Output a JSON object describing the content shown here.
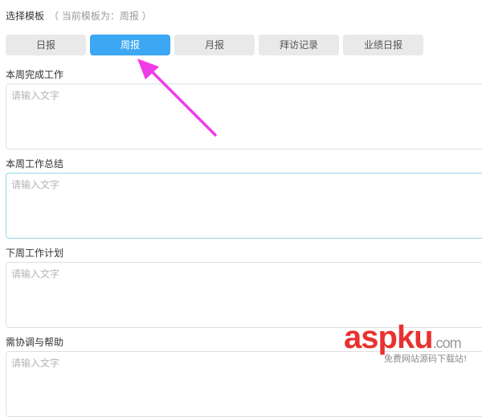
{
  "header": {
    "label": "选择模板",
    "hint": "（ 当前模板为：周报 ）"
  },
  "tabs": [
    {
      "label": "日报",
      "active": false
    },
    {
      "label": "周报",
      "active": true
    },
    {
      "label": "月报",
      "active": false
    },
    {
      "label": "拜访记录",
      "active": false
    },
    {
      "label": "业绩日报",
      "active": false
    }
  ],
  "sections": [
    {
      "title": "本周完成工作",
      "placeholder": "请输入文字",
      "value": ""
    },
    {
      "title": "本周工作总结",
      "placeholder": "请输入文字",
      "value": ""
    },
    {
      "title": "下周工作计划",
      "placeholder": "请输入文字",
      "value": ""
    },
    {
      "title": "需协调与帮助",
      "placeholder": "请输入文字",
      "value": ""
    }
  ],
  "colors": {
    "accent": "#3ca7f3",
    "arrow": "#f03ce6",
    "focus_border": "#8fd8e8"
  },
  "annotation": {
    "type": "arrow",
    "points_to": "tab-weekly"
  },
  "watermark": {
    "brand_red": "asp",
    "brand_gray": "ku",
    "brand_suffix": ".com",
    "tagline": "免费网站源码下载站!"
  }
}
